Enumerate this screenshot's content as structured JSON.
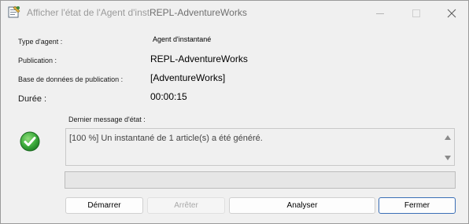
{
  "window": {
    "title_prefix": "Afficher l'état de l'Agent d'insta",
    "title_suffix": "REPL-AdventureWorks"
  },
  "fields": {
    "agent_type_label": "Type d'agent :",
    "agent_type_value": "Agent d'instantané",
    "publication_label": "Publication :",
    "publication_value": "REPL-AdventureWorks",
    "db_label": "Base de données de publication :",
    "db_value": "[AdventureWorks]",
    "duration_label": "Durée :",
    "duration_value": "00:00:15"
  },
  "status": {
    "last_message_label": "Dernier message d'état :",
    "message": "[100 %] Un instantané de 1 article(s) a été généré.",
    "icon": "check-circle-icon",
    "icon_color": "#3cab3c"
  },
  "buttons": {
    "start": "Démarrer",
    "stop": "Arrêter",
    "analyze": "Analyser",
    "close": "Fermer"
  }
}
